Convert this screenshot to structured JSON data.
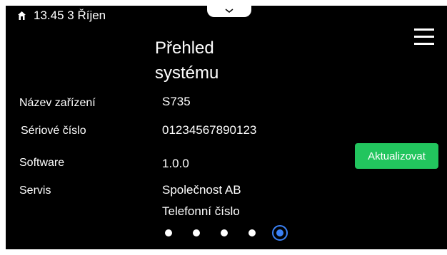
{
  "status_bar": {
    "icon": "home-icon",
    "text": "13.45 3 Říjen"
  },
  "header": {
    "title_line1": "Přehled",
    "title_line2": "systému",
    "menu_icon": "hamburger-menu-icon"
  },
  "info": {
    "rows": [
      {
        "label": "Název zařízení",
        "value": "S735"
      },
      {
        "label": "Sériové číslo",
        "value": "01234567890123"
      },
      {
        "label": "Software",
        "value": "1.0.0"
      },
      {
        "label": "Servis",
        "value": "Společnost AB",
        "value2": "Telefonní číslo"
      }
    ]
  },
  "actions": {
    "update_label": "Aktualizovat"
  },
  "pager": {
    "total": 5,
    "active_index": 4
  },
  "colors": {
    "background": "#000000",
    "text": "#ffffff",
    "update_button": "#22c55e",
    "active_page": "#3b82f6"
  }
}
